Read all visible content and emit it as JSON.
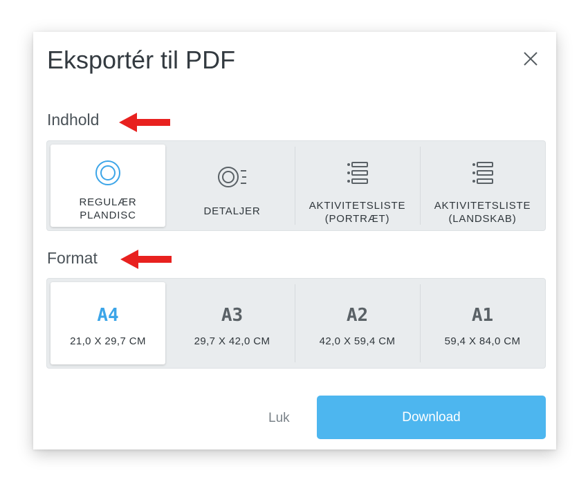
{
  "dialog": {
    "title": "Eksportér til PDF",
    "close_icon": "close-icon"
  },
  "content_section": {
    "label": "Indhold",
    "options": [
      {
        "label": "REGULÆR\nPLANDISC",
        "icon": "target-circle-icon",
        "selected": true
      },
      {
        "label": "DETALJER",
        "icon": "details-circle-icon",
        "selected": false
      },
      {
        "label": "AKTIVITETSLISTE\n(PORTRÆT)",
        "icon": "list-icon",
        "selected": false
      },
      {
        "label": "AKTIVITETSLISTE\n(LANDSKAB)",
        "icon": "list-icon",
        "selected": false
      }
    ]
  },
  "format_section": {
    "label": "Format",
    "options": [
      {
        "name": "A4",
        "size": "21,0 X 29,7 CM",
        "selected": true
      },
      {
        "name": "A3",
        "size": "29,7 X 42,0 CM",
        "selected": false
      },
      {
        "name": "A2",
        "size": "42,0 X 59,4 CM",
        "selected": false
      },
      {
        "name": "A1",
        "size": "59,4 X 84,0 CM",
        "selected": false
      }
    ]
  },
  "footer": {
    "close_label": "Luk",
    "download_label": "Download"
  },
  "colors": {
    "accent": "#3ca5e8",
    "button": "#4db6ef",
    "annotation_arrow": "#e8211f"
  }
}
